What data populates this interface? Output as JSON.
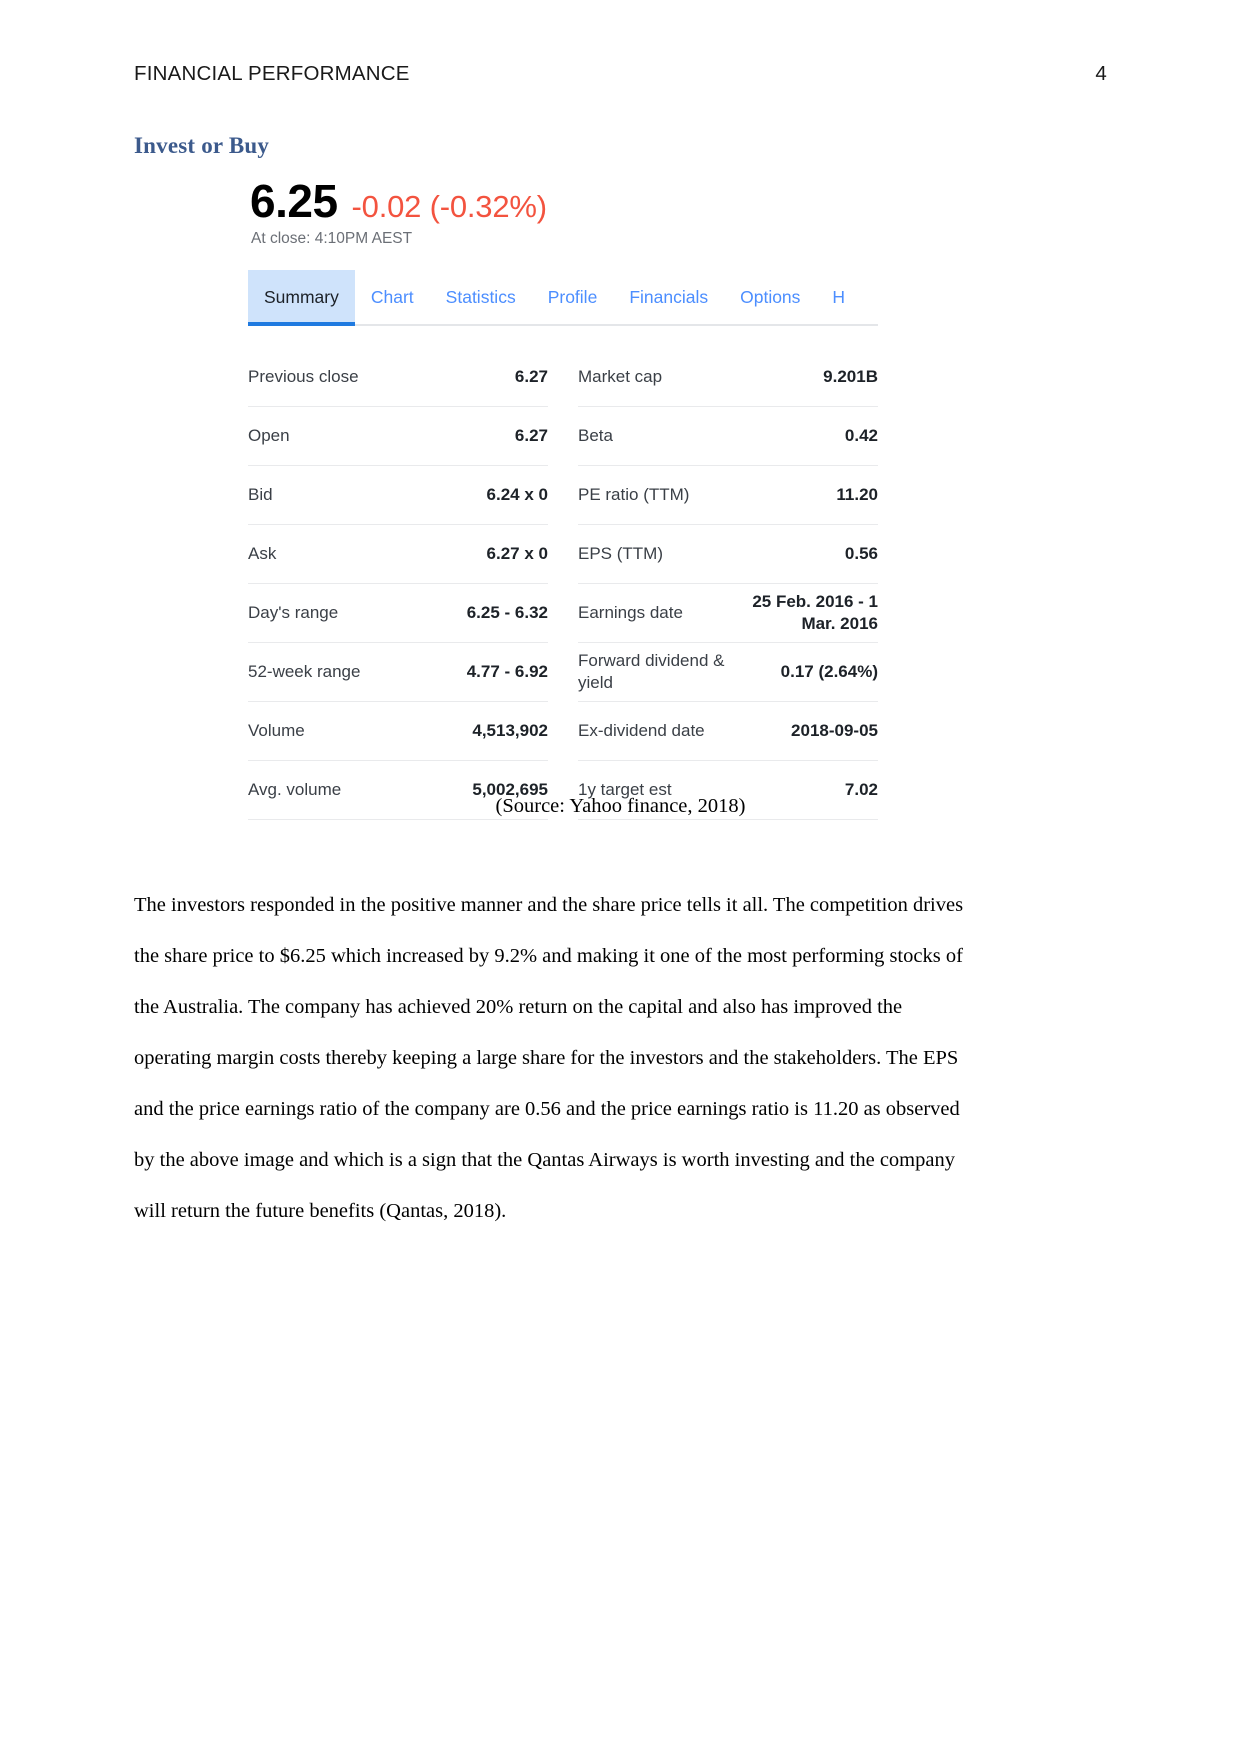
{
  "header": {
    "running_title": "FINANCIAL PERFORMANCE",
    "page_number": "4"
  },
  "section": {
    "heading": "Invest or Buy"
  },
  "quote": {
    "price": "6.25",
    "change": "-0.02 (-0.32%)",
    "close_note": "At close: 4:10PM AEST",
    "price_color": "#000000",
    "change_color": "#f3533f"
  },
  "tabs": {
    "active": "Summary",
    "accent_color": "#1f7ae0",
    "active_bg": "#cfe3fb",
    "link_color": "#4c8eff",
    "items": [
      {
        "label": "Summary"
      },
      {
        "label": "Chart"
      },
      {
        "label": "Statistics"
      },
      {
        "label": "Profile"
      },
      {
        "label": "Financials"
      },
      {
        "label": "Options"
      },
      {
        "label": "H"
      }
    ]
  },
  "stats": {
    "left": [
      {
        "label": "Previous close",
        "value": "6.27"
      },
      {
        "label": "Open",
        "value": "6.27"
      },
      {
        "label": "Bid",
        "value": "6.24 x 0"
      },
      {
        "label": "Ask",
        "value": "6.27 x 0"
      },
      {
        "label": "Day's range",
        "value": "6.25 - 6.32"
      },
      {
        "label": "52-week range",
        "value": "4.77 - 6.92"
      },
      {
        "label": "Volume",
        "value": "4,513,902"
      },
      {
        "label": "Avg. volume",
        "value": "5,002,695"
      }
    ],
    "right": [
      {
        "label": "Market cap",
        "value": "9.201B"
      },
      {
        "label": "Beta",
        "value": "0.42"
      },
      {
        "label": "PE ratio (TTM)",
        "value": "11.20"
      },
      {
        "label": "EPS (TTM)",
        "value": "0.56"
      },
      {
        "label": "Earnings date",
        "value": "25 Feb. 2016 - 1\nMar. 2016"
      },
      {
        "label": "Forward dividend\n& yield",
        "value": "0.17 (2.64%)"
      },
      {
        "label": "Ex-dividend date",
        "value": "2018-09-05"
      },
      {
        "label": "1y target est",
        "value": "7.02"
      }
    ]
  },
  "caption": {
    "source": "(Source: Yahoo finance, 2018)"
  },
  "body": {
    "paragraph": "The investors responded in the positive manner and the share price tells it all. The competition drives the share price to $6.25 which increased by 9.2% and making it one of the most performing stocks of the Australia. The company has achieved 20% return on the capital and also has improved the operating margin costs thereby keeping a large share for the investors and the stakeholders. The EPS and the price earnings ratio of the company are 0.56 and the price earnings ratio is 11.20 as observed by the above image and which is a sign that the Qantas Airways is worth investing and the company will return the future benefits (Qantas, 2018)."
  }
}
